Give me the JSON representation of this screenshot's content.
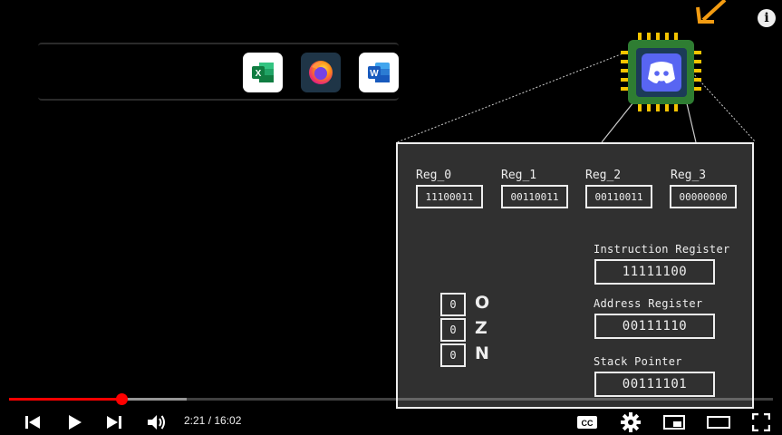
{
  "taskbar": {
    "apps": [
      {
        "name": "Excel",
        "glyph": "X"
      },
      {
        "name": "Firefox"
      },
      {
        "name": "Word",
        "glyph": "W"
      }
    ]
  },
  "info_button": {
    "label": "i"
  },
  "chip": {
    "icon": "discord-icon"
  },
  "cpu": {
    "registers": [
      {
        "label": "Reg_0",
        "value": "11100011"
      },
      {
        "label": "Reg_1",
        "value": "00110011"
      },
      {
        "label": "Reg_2",
        "value": "00110011"
      },
      {
        "label": "Reg_3",
        "value": "00000000"
      }
    ],
    "instruction_register": {
      "label": "Instruction Register",
      "value": "11111100"
    },
    "address_register": {
      "label": "Address Register",
      "value": "00111110"
    },
    "stack_pointer": {
      "label": "Stack Pointer",
      "value": "00111101"
    },
    "flags": [
      {
        "value": "0",
        "letter": "O"
      },
      {
        "value": "0",
        "letter": "Z"
      },
      {
        "value": "0",
        "letter": "N"
      }
    ]
  },
  "player": {
    "current_time": "2:21",
    "duration": "16:02",
    "time_display": "2:21 / 16:02",
    "progress_fraction": 0.1466,
    "buffered_fraction": 0.232,
    "colors": {
      "played": "#ff0000",
      "accent_orange": "#f39c12",
      "chip_green": "#2e7d32",
      "chip_pins": "#f5c400"
    }
  }
}
